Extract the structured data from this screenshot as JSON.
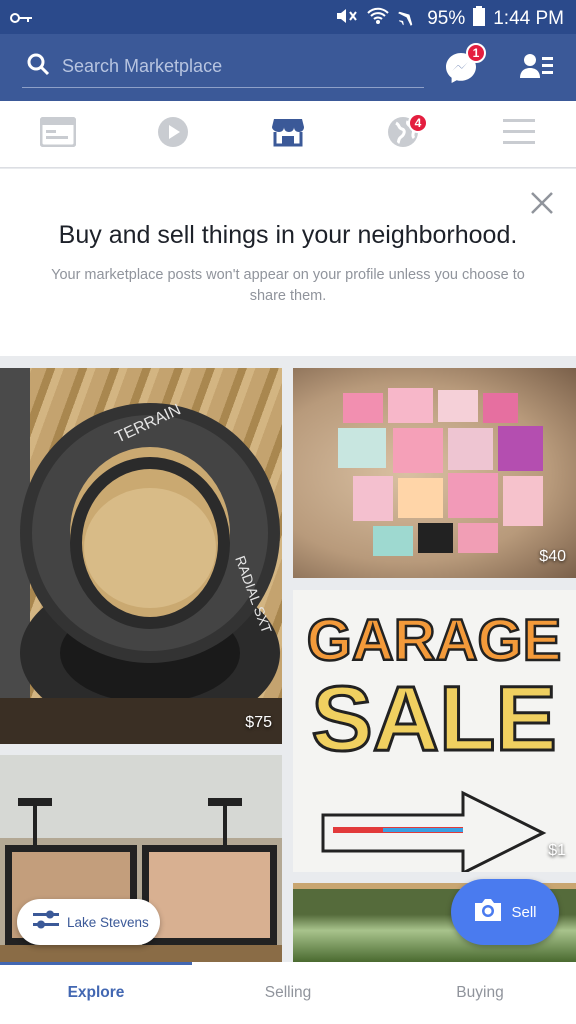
{
  "status_bar": {
    "battery": "95%",
    "time": "1:44 PM"
  },
  "search": {
    "placeholder": "Search Marketplace"
  },
  "header": {
    "messenger_badge": "1"
  },
  "tabs": [
    {
      "name": "news-feed",
      "icon": "newsfeed-icon"
    },
    {
      "name": "watch",
      "icon": "play-icon"
    },
    {
      "name": "marketplace",
      "icon": "shop-icon",
      "active": true
    },
    {
      "name": "notifications",
      "icon": "globe-icon",
      "badge": "4"
    },
    {
      "name": "menu",
      "icon": "hamburger-icon"
    }
  ],
  "banner": {
    "title": "Buy and sell things in your neighborhood.",
    "subtitle": "Your marketplace posts won't appear on your profile unless you choose to share them."
  },
  "listings": [
    {
      "name": "tires",
      "price": "$75"
    },
    {
      "name": "baby-clothes",
      "price": "$40"
    },
    {
      "name": "garage-sale",
      "price": "$1"
    },
    {
      "name": "framed-pictures",
      "price": ""
    },
    {
      "name": "trees",
      "price": ""
    }
  ],
  "garage_sign": {
    "line1": "GARAGE",
    "line2": "SALE"
  },
  "location_chip": {
    "label": "Lake Stevens"
  },
  "sell_button": {
    "label": "Sell"
  },
  "bottom_nav": {
    "explore": "Explore",
    "selling": "Selling",
    "buying": "Buying"
  },
  "colors": {
    "header_blue": "#3b5998",
    "status_blue": "#2b4a8b",
    "accent": "#4267b2",
    "badge_red": "#e41e3f",
    "sell_blue": "#4a7bef"
  }
}
